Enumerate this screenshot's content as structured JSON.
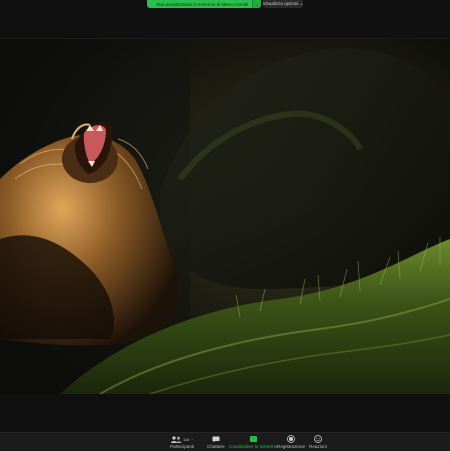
{
  "top": {
    "share_notice": "Stai visualizzando lo schermo di Marco Gentili",
    "share_dropdown": "⌄",
    "view_options": "Visualizza opzioni ⌄"
  },
  "toolbar": {
    "participants_label": "Partecipanti",
    "participants_count": "116",
    "chat_label": "Chattare",
    "share_label": "Condividere lo schermo",
    "record_label": "Registrazione",
    "reactions_label": "Reazioni",
    "caret": "^"
  },
  "colors": {
    "share_green": "#2dbf4e",
    "bar_bg": "#101010",
    "toolbar_bg": "#1b1b1b"
  },
  "icons": {
    "participants": "people-icon",
    "chat": "chat-bubble-icon",
    "share": "share-screen-icon",
    "record": "record-icon",
    "reactions": "smiley-icon"
  }
}
